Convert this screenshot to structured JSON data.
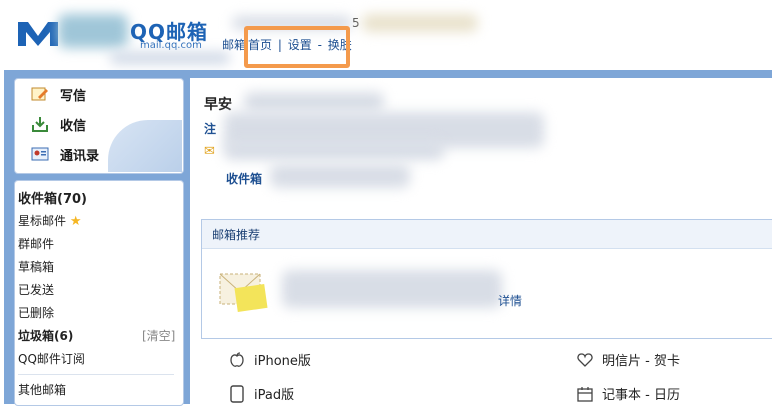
{
  "header": {
    "logo_text": "QQ邮箱",
    "logo_sub": "mail.qq.com",
    "account_fragment": "5",
    "links": [
      "邮箱",
      "首页",
      "|",
      "设置",
      "-",
      "换肤"
    ]
  },
  "sidebar": {
    "actions": [
      {
        "label": "写信",
        "icon": "compose-icon"
      },
      {
        "label": "收信",
        "icon": "receive-icon"
      },
      {
        "label": "通讯录",
        "icon": "contacts-icon"
      }
    ],
    "folders": {
      "inbox": "收件箱(70)",
      "starred": "星标邮件",
      "group": "群邮件",
      "drafts": "草稿箱",
      "sent": "已发送",
      "deleted": "已删除",
      "junk": "垃圾箱(6)",
      "clear_label": "[清空]",
      "subscriptions": "QQ邮件订阅",
      "other": "其他邮箱"
    }
  },
  "main": {
    "greeting": "早安",
    "reg_prefix": "注",
    "inbox_label": "收件箱",
    "recommend_title": "邮箱推荐",
    "details_link": "详情",
    "apps": [
      {
        "label": "iPhone版",
        "icon": "apple-icon"
      },
      {
        "label": "iPad版",
        "icon": "tablet-icon"
      },
      {
        "label": "明信片 - 贺卡",
        "icon": "heart-icon"
      },
      {
        "label": "记事本 - 日历",
        "icon": "calendar-icon"
      }
    ]
  },
  "colors": {
    "frame": "#7ea6d7",
    "highlight": "#f49a4c",
    "brand": "#1d63b5"
  }
}
